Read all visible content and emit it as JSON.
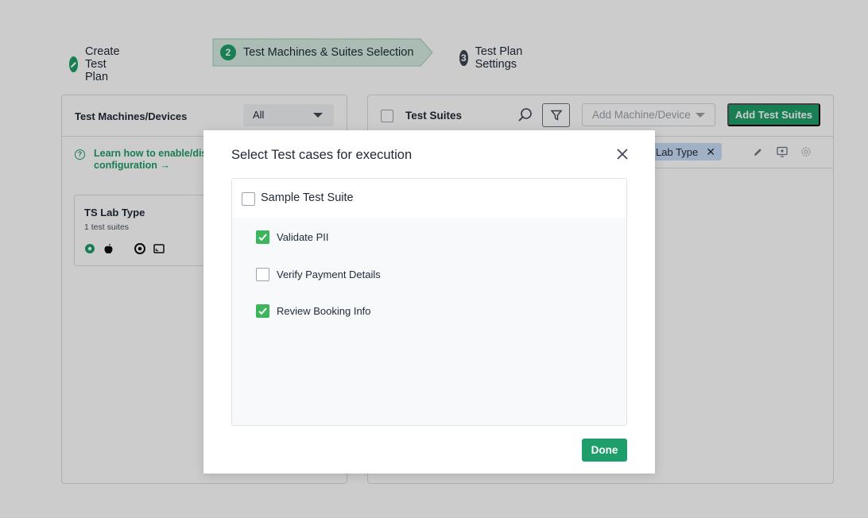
{
  "stepper": {
    "steps": [
      {
        "number": "",
        "label": "Create Test Plan",
        "icon": "pencil-icon"
      },
      {
        "number": "2",
        "label": "Test Machines & Suites Selection"
      },
      {
        "number": "3",
        "label": "Test Plan Settings"
      }
    ],
    "active_color": "#1e9e6a"
  },
  "left_panel": {
    "title": "Test Machines/Devices",
    "filter": {
      "selected": "All"
    },
    "info_text_line1": "Learn how to enable/disa",
    "info_text_line2": "configuration →",
    "lab_card": {
      "title": "TS Lab Type",
      "subtitle": "1 test suites"
    }
  },
  "right_panel": {
    "title": "Test Suites",
    "add_machine_placeholder": "Add Machine/Device",
    "add_suites_label": "Add Test Suites",
    "chip_label": "Lab Type",
    "chip_remove": "✕"
  },
  "modal": {
    "title": "Select Test cases for execution",
    "close": "✕",
    "suite": {
      "name": "Sample Test Suite",
      "checked": false
    },
    "cases": [
      {
        "label": "Validate PII",
        "checked": true
      },
      {
        "label": "Verify Payment Details",
        "checked": false
      },
      {
        "label": "Review Booking Info",
        "checked": true
      }
    ],
    "done_label": "Done"
  },
  "colors": {
    "primary": "#1e9e6a",
    "checkbox_checked": "#3cb55b",
    "chip_bg": "#c9dcf7"
  }
}
